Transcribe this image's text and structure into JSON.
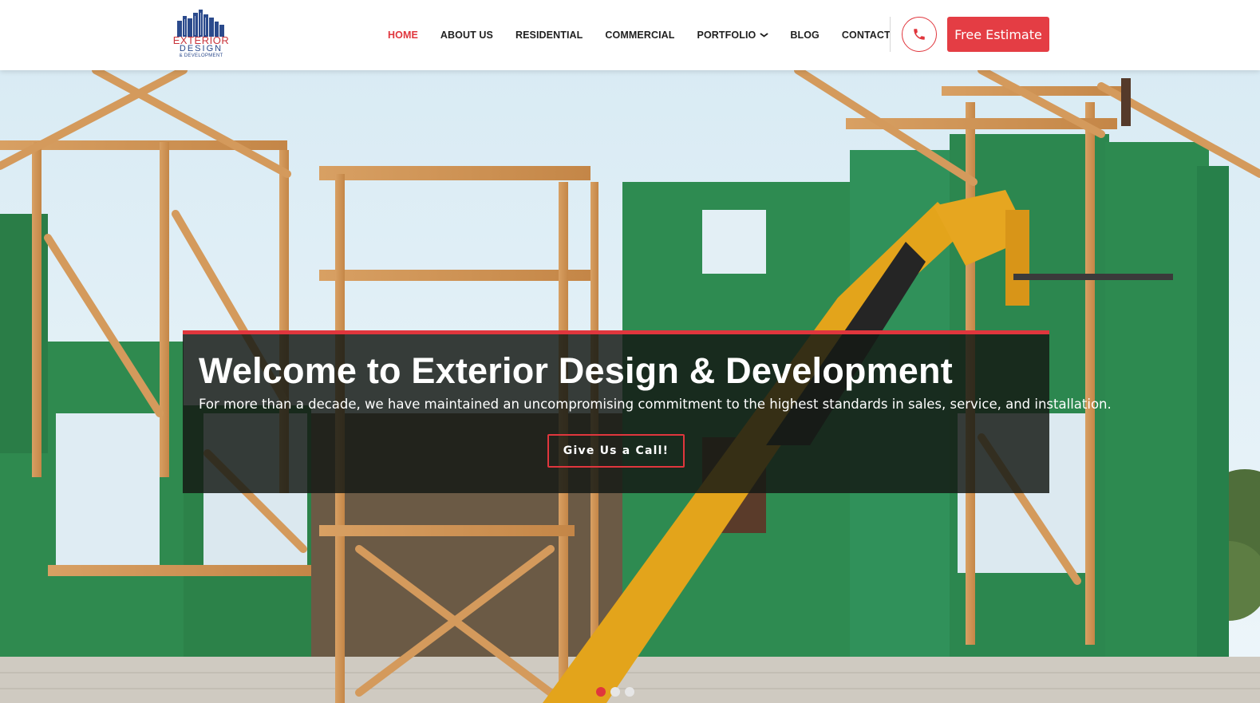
{
  "brand": {
    "logo_line1": "EXTERIOR",
    "logo_line2": "DESIGN",
    "logo_line3": "& DEVELOPMENT",
    "accent_color": "#e0363d",
    "logo_blue": "#2b4a8c"
  },
  "nav": {
    "items": [
      {
        "label": "HOME",
        "active": true
      },
      {
        "label": "ABOUT US",
        "active": false
      },
      {
        "label": "RESIDENTIAL",
        "active": false
      },
      {
        "label": "COMMERCIAL",
        "active": false
      },
      {
        "label": "PORTFOLIO",
        "active": false,
        "has_dropdown": true
      },
      {
        "label": "BLOG",
        "active": false
      },
      {
        "label": "CONTACT",
        "active": false
      }
    ],
    "dropdown_icon": "chevron-down-icon",
    "phone_icon": "phone-icon",
    "cta_label": "Free Estimate"
  },
  "hero": {
    "title": "Welcome to Exterior Design & Development",
    "subtitle": "For more than a decade, we have maintained an uncompromising commitment to the highest standards in sales, service, and installation.",
    "button_label": "Give Us a Call!",
    "slides_total": 3,
    "active_slide": 1,
    "image": "house-framing-construction-with-crane-photo"
  }
}
